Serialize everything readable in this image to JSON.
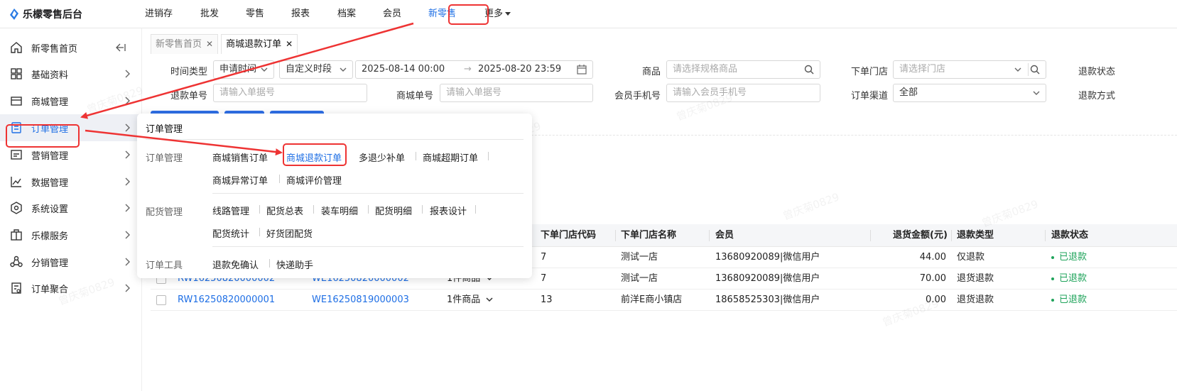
{
  "app": {
    "title": "乐檬零售后台"
  },
  "topnav": [
    {
      "label": "进销存",
      "active": false
    },
    {
      "label": "批发",
      "active": false
    },
    {
      "label": "零售",
      "active": false
    },
    {
      "label": "报表",
      "active": false
    },
    {
      "label": "档案",
      "active": false
    },
    {
      "label": "会员",
      "active": false
    },
    {
      "label": "新零售",
      "active": true
    },
    {
      "label": "更多",
      "active": false,
      "dropdown": true
    }
  ],
  "sidebar": {
    "items": [
      {
        "label": "新零售首页",
        "icon": "home-icon",
        "selected": false,
        "collapse_icon": true
      },
      {
        "label": "基础资料",
        "icon": "grid-icon",
        "selected": false
      },
      {
        "label": "商城管理",
        "icon": "store-icon",
        "selected": false
      },
      {
        "label": "订单管理",
        "icon": "order-icon",
        "selected": true
      },
      {
        "label": "营销管理",
        "icon": "marketing-icon",
        "selected": false
      },
      {
        "label": "数据管理",
        "icon": "chart-line-icon",
        "selected": false
      },
      {
        "label": "系统设置",
        "icon": "settings-icon",
        "selected": false
      },
      {
        "label": "乐檬服务",
        "icon": "briefcase-icon",
        "selected": false
      },
      {
        "label": "分销管理",
        "icon": "distribution-icon",
        "selected": false
      },
      {
        "label": "订单聚合",
        "icon": "aggregate-icon",
        "selected": false
      }
    ]
  },
  "tabs": [
    {
      "label": "新零售首页",
      "current": false
    },
    {
      "label": "商城退款订单",
      "current": true
    }
  ],
  "filters": {
    "time_type": {
      "label": "时间类型",
      "value": "申请时间"
    },
    "period": {
      "value": "自定义时段"
    },
    "date_range": {
      "start": "2025-08-14 00:00",
      "end": "2025-08-20 23:59"
    },
    "product": {
      "label": "商品",
      "placeholder": "请选择规格商品"
    },
    "store": {
      "label": "下单门店",
      "placeholder": "请选择门店"
    },
    "refund_status": {
      "label": "退款状态"
    },
    "refund_no": {
      "label": "退款单号",
      "placeholder": "请输入单据号"
    },
    "mall_no": {
      "label": "商城单号",
      "placeholder": "请输入单据号"
    },
    "member_phone": {
      "label": "会员手机号",
      "placeholder": "请输入会员手机号"
    },
    "channel": {
      "label": "订单渠道",
      "value": "全部"
    },
    "refund_method": {
      "label": "退款方式"
    }
  },
  "table": {
    "columns": [
      "下单门店代码",
      "下单门店名称",
      "会员",
      "退货金额(元)",
      "退款类型",
      "退款状态"
    ],
    "rows": [
      {
        "refund_no": "",
        "mall_no": "",
        "items": "",
        "store_code": "7",
        "store_name": "测试一店",
        "member": "13680920089|微信用户",
        "amount": "44.00",
        "type": "仅退款",
        "status": "已退款"
      },
      {
        "refund_no": "RW16250820000002",
        "mall_no": "WE16250820000002",
        "items": "1件商品",
        "store_code": "7",
        "store_name": "测试一店",
        "member": "13680920089|微信用户",
        "amount": "70.00",
        "type": "退货退款",
        "status": "已退款"
      },
      {
        "refund_no": "RW16250820000001",
        "mall_no": "WE16250819000003",
        "items": "1件商品",
        "store_code": "13",
        "store_name": "前洋E商小镇店",
        "member": "18658525303|微信用户",
        "amount": "0.00",
        "type": "退货退款",
        "status": "已退款"
      }
    ]
  },
  "menu": {
    "title": "订单管理",
    "groups": [
      {
        "label": "订单管理",
        "links": [
          "商城销售订单",
          "商城退款订单",
          "多退少补单",
          "商城超期订单",
          "商城异常订单",
          "商城评价管理"
        ]
      },
      {
        "label": "配货管理",
        "links": [
          "线路管理",
          "配货总表",
          "装车明细",
          "配货明细",
          "报表设计",
          "配货统计",
          "好货团配货"
        ]
      },
      {
        "label": "订单工具",
        "links": [
          "退款免确认",
          "快递助手"
        ]
      }
    ],
    "active_link": "商城退款订单"
  },
  "watermark": {
    "text": "曾庆菊0829"
  },
  "colors": {
    "accent": "#1f6fe5",
    "highlight": "#e33333",
    "success": "#1ea35a"
  }
}
